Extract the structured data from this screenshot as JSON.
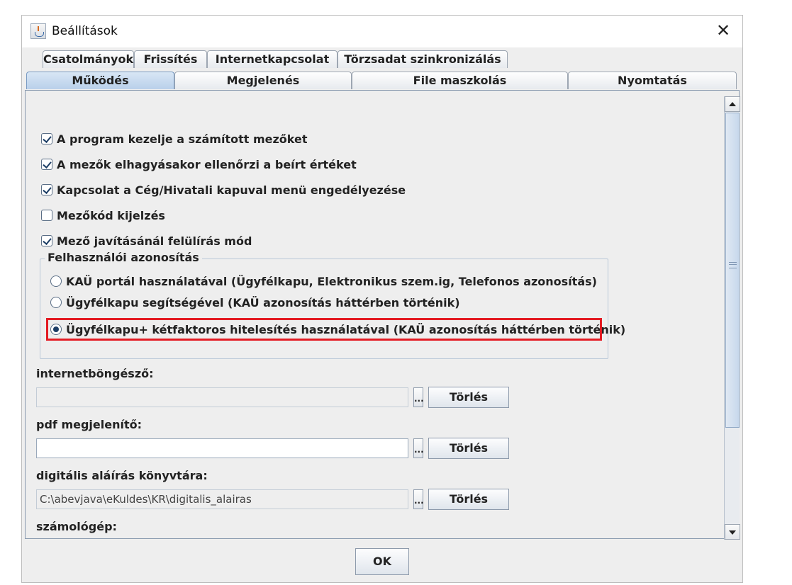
{
  "window": {
    "title": "Beállítások"
  },
  "tabs_row1": [
    "Csatolmányok",
    "Frissítés",
    "Internetkapcsolat",
    "Törzsadat szinkronizálás"
  ],
  "tabs_row2": [
    "Működés",
    "Megjelenés",
    "File maszkolás",
    "Nyomtatás"
  ],
  "active_tab": "Működés",
  "checkboxes": [
    {
      "label": "A program kezelje a számított mezőket",
      "checked": true
    },
    {
      "label": "A mezők elhagyásakor ellenőrzi a beírt értéket",
      "checked": true
    },
    {
      "label": "Kapcsolat a Cég/Hivatali kapuval menü engedélyezése",
      "checked": true
    },
    {
      "label": "Mezőkód kijelzés",
      "checked": false
    },
    {
      "label": "Mező javításánál felülírás mód",
      "checked": true
    }
  ],
  "auth_group": {
    "legend": "Felhasználói azonosítás",
    "options": [
      {
        "label": "KAÜ portál használatával (Ügyfélkapu, Elektronikus szem.ig, Telefonos azonosítás)",
        "selected": false
      },
      {
        "label": "Ügyfélkapu segítségével (KAÜ azonosítás háttérben történik)",
        "selected": false
      },
      {
        "label": "Ügyfélkapu+ kétfaktoros hitelesítés használatával (KAÜ azonosítás háttérben történik)",
        "selected": true
      }
    ]
  },
  "fields": [
    {
      "label": "internetböngésző:",
      "value": "",
      "browse": "...",
      "clear": "Törlés",
      "disabled": true
    },
    {
      "label": "pdf megjelenítő:",
      "value": "",
      "browse": "...",
      "clear": "Törlés",
      "disabled": false
    },
    {
      "label": "digitális aláírás könyvtára:",
      "value": "C:\\abevjava\\eKuldes\\KR\\digitalis_alairas",
      "browse": "...",
      "clear": "Törlés",
      "disabled": true
    }
  ],
  "next_label": "számológép:",
  "ok_label": "OK",
  "colors": {
    "highlight": "#e31b23",
    "active_tab": "#b9d0ea"
  }
}
